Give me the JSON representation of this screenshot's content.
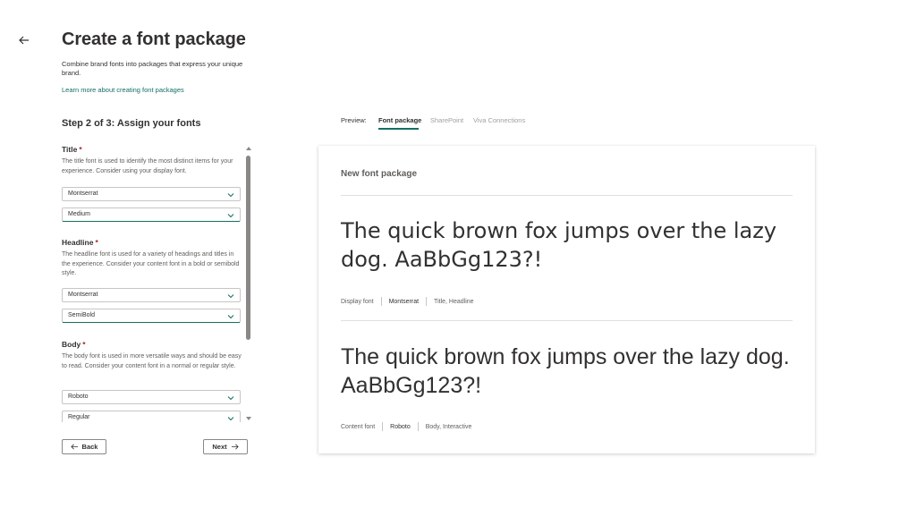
{
  "page": {
    "title": "Create a font package",
    "subtitle": "Combine brand fonts into packages that express your unique brand.",
    "learn_link": "Learn more about creating font packages"
  },
  "wizard": {
    "step": "Step 2 of 3: Assign your fonts",
    "sections": [
      {
        "title": "Title",
        "required": "*",
        "description": "The title font is used to identify the most distinct items for your experience. Consider using your display font.",
        "font": "Montserrat",
        "weight": "Medium"
      },
      {
        "title": "Headline",
        "required": "*",
        "description": "The headline font is used for a variety of headings and titles in the experience. Consider your content font in a bold or semibold style.",
        "font": "Montserrat",
        "weight": "SemiBold"
      },
      {
        "title": "Body",
        "required": "*",
        "description": "The body font is used in more versatile ways and should be easy to read. Consider your content font in a normal or regular style.",
        "font": "Roboto",
        "weight": "Regular"
      }
    ],
    "back_label": "Back",
    "next_label": "Next"
  },
  "preview": {
    "label": "Preview:",
    "tabs": [
      {
        "label": "Font package",
        "active": true
      },
      {
        "label": "SharePoint",
        "active": false
      },
      {
        "label": "Viva Connections",
        "active": false
      }
    ],
    "card": {
      "title": "New font package",
      "display_sample": "The quick brown fox jumps over the lazy dog. AaBbGg123?!",
      "display_kind": "Display font",
      "display_font": "Montserrat",
      "display_usage": "Title, Headline",
      "content_sample": "The quick brown fox jumps over the lazy dog. AaBbGg123?!",
      "content_kind": "Content font",
      "content_font": "Roboto",
      "content_usage": "Body, Interactive"
    }
  },
  "colors": {
    "accent": "#136f63",
    "required": "#a4262c",
    "text": "#323130",
    "muted": "#605e5c"
  },
  "icons": {
    "back": "arrow-left-icon",
    "dropdown": "chevron-down-icon",
    "next": "arrow-right-icon"
  }
}
